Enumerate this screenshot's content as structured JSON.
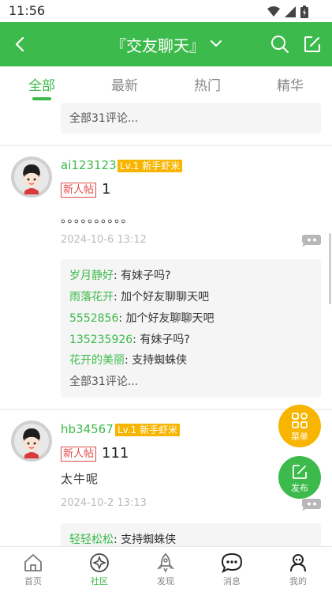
{
  "status_bar": {
    "time": "11:56"
  },
  "header": {
    "title": "『交友聊天』"
  },
  "tabs": [
    "全部",
    "最新",
    "热门",
    "精华"
  ],
  "posts": [
    {
      "all_comments": "全部31评论..."
    },
    {
      "username": "ai123123",
      "level": "Lv.1 新手虾米",
      "new_tag": "新人帖",
      "title": "1",
      "body": "。。。。。。。。。。",
      "date": "2024-10-6 13:12",
      "comments": [
        {
          "name": "岁月静好",
          "text": ": 有妹子吗?"
        },
        {
          "name": "雨落花开",
          "text": ": 加个好友聊聊天吧"
        },
        {
          "name": "5552856",
          "text": ": 加个好友聊聊天吧"
        },
        {
          "name": "135235926",
          "text": ": 有妹子吗?"
        },
        {
          "name": "花开的美丽",
          "text": ": 支持蜘蛛侠"
        }
      ],
      "all_comments": "全部31评论..."
    },
    {
      "username": "hb34567",
      "level": "Lv.1 新手虾米",
      "new_tag": "新人帖",
      "title": "111",
      "body": "太牛呢",
      "date": "2024-10-2 13:13",
      "comments": [
        {
          "name": "轻轻松松",
          "text": ": 支持蜘蛛侠"
        }
      ]
    }
  ],
  "fabs": {
    "menu": "菜单",
    "post": "发布"
  },
  "bottom_nav": [
    "首页",
    "社区",
    "发现",
    "消息",
    "我的"
  ],
  "colors": {
    "brand": "#3cba4b",
    "badge": "#f7b500",
    "new_tag": "#e24a4a"
  }
}
